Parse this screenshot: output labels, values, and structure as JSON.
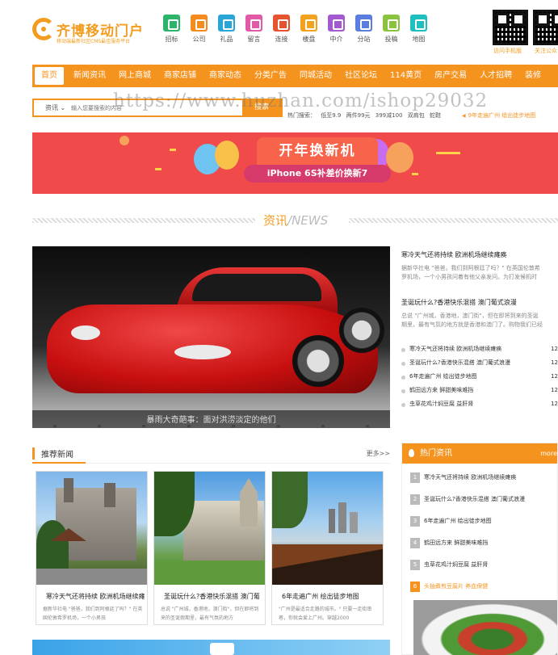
{
  "header": {
    "logo_title": "齐博移动门户",
    "logo_sub": "移动端最新社区CMS最佳服务平台",
    "nav": [
      {
        "label": "招标",
        "color": "#2db46b",
        "icon": "tender-icon"
      },
      {
        "label": "公司",
        "color": "#f58a1f",
        "icon": "company-icon"
      },
      {
        "label": "礼品",
        "color": "#2aa6d6",
        "icon": "gift-icon"
      },
      {
        "label": "留言",
        "color": "#e05aa8",
        "icon": "message-icon"
      },
      {
        "label": "连接",
        "color": "#e8532f",
        "icon": "link-icon"
      },
      {
        "label": "楼盘",
        "color": "#f3a21d",
        "icon": "building-icon"
      },
      {
        "label": "中介",
        "color": "#a35ad1",
        "icon": "agent-icon"
      },
      {
        "label": "分站",
        "color": "#5a7de0",
        "icon": "branch-icon"
      },
      {
        "label": "投稿",
        "color": "#8ac43f",
        "icon": "submit-icon"
      },
      {
        "label": "地图",
        "color": "#1fbfbf",
        "icon": "map-icon"
      }
    ],
    "qr1_label": "访问手机版",
    "qr2_label": "关注公众"
  },
  "mainnav": [
    "首页",
    "新闻资讯",
    "网上商城",
    "商家店铺",
    "商家动态",
    "分类广告",
    "同城活动",
    "社区论坛",
    "114黄页",
    "房产交易",
    "人才招聘",
    "装修"
  ],
  "search": {
    "category": "资讯",
    "placeholder": "输入您要搜索的内容",
    "button": "搜索",
    "hot_label": "热门搜索：",
    "hot_terms": [
      "低至9.9",
      "两件99元",
      "399减100",
      "双肩包",
      "蛇鞋"
    ],
    "notice": "9年走遍广州 绘出徒步地图"
  },
  "watermark": "https://www.huzhan.com/ishop29032",
  "banner": {
    "title": "开年换新机",
    "subtitle": "iPhone 6S补差价换新7"
  },
  "section": {
    "cn": "资讯",
    "en": "/NEWS"
  },
  "slider": {
    "caption": "暴雨大奇葩事：面对洪涝淡定的他们"
  },
  "right_news": {
    "item1_title": "寒冷天气还将持续 欧洲机场继续瘫痪",
    "item1_desc1": "据新华社电 \"爸爸，我们到阿根廷了吗？\" 在英国伦敦希",
    "item1_desc2": "罗机场，一个小男孩问着有他父亲发问。为打发候机时",
    "item2_title": "圣诞玩什么?香港快乐混搭 澳门葡式浪漫",
    "item2_desc1": "总说 \"广州城，香港地，澳门街\"，但在即将到来的圣诞",
    "item2_desc2": "期里，最有气氛的地方就是香港和澳门了。购物我们已经",
    "list": [
      {
        "t": "寒冷天气还将持续 欧洲机场继续瘫痪",
        "d": "12"
      },
      {
        "t": "圣诞玩什么?香港快乐混搭 澳门葡式浪漫",
        "d": "12"
      },
      {
        "t": "6年走遍广州 绘出徒步地图",
        "d": "12"
      },
      {
        "t": "鹤田远方来 鲜甜美味难挡",
        "d": "12"
      },
      {
        "t": "虫草花鸡汁焖豆腐 益肝肾",
        "d": "12"
      }
    ]
  },
  "recommend": {
    "title": "推荐新闻",
    "more": "更多>>",
    "cards": [
      {
        "title": "寒冷天气还将持续 欧洲机场继续瘫痪",
        "desc": "据新华社电 \"爸爸，我们到阿根廷了吗？\" 在英国伦敦希罗机场，一个小男孩"
      },
      {
        "title": "圣诞玩什么?香港快乐混搭 澳门葡",
        "desc": "总说 \"广州城，香港地，澳门街\"，但在即将到来的圣诞假期里，最有气氛的地方"
      },
      {
        "title": "6年走遍广州 绘出徒步地图",
        "desc": "\"广州是最适合走路的城市。\" 只要一走街串巷，你就会爱上广州。穿越2000"
      }
    ]
  },
  "hot": {
    "title": "热门资讯",
    "more": "more",
    "items": [
      {
        "n": "1",
        "t": "寒冷天气还将持续 欧洲机场继续瘫痪"
      },
      {
        "n": "2",
        "t": "圣诞玩什么?香港快乐混搭 澳门葡式浪漫"
      },
      {
        "n": "3",
        "t": "6年走遍广州 绘出徒步地图"
      },
      {
        "n": "4",
        "t": "鹤田远方来 鲜甜美味难挡"
      },
      {
        "n": "5",
        "t": "虫草花鸡汁焖豆腐 益肝肾"
      },
      {
        "n": "6",
        "t": "头抽煮煎豆腐片 养血保健"
      }
    ]
  }
}
